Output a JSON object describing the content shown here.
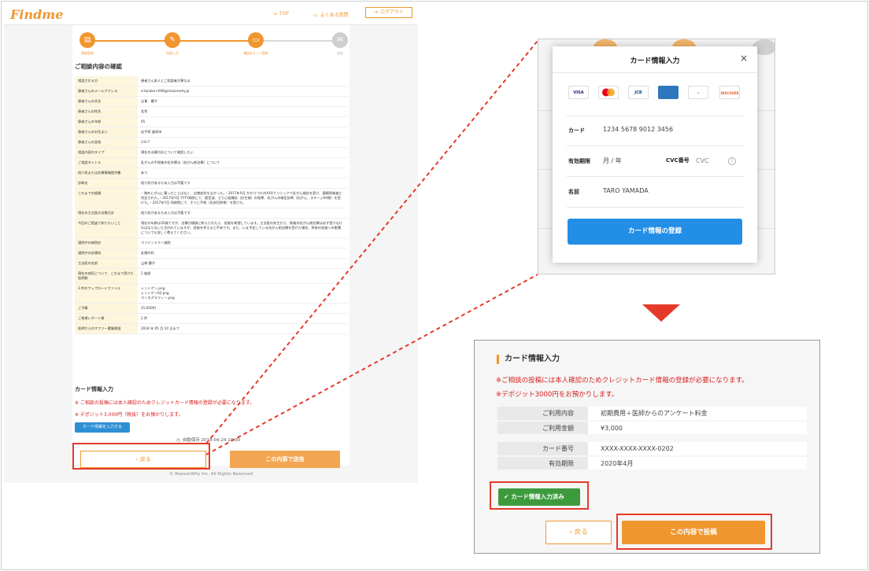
{
  "left_page": {
    "logo": "Findme",
    "nav": {
      "top": "TOP",
      "faq": "よくある質問",
      "logout": "ログアウト"
    },
    "steps": [
      "相談登録",
      "内容入力",
      "確認&カード登録",
      "送信"
    ],
    "title": "ご相談内容の確認",
    "rows": [
      {
        "k": "相談される方",
        "v": "患者さん本人とご相談者が異なる"
      },
      {
        "k": "患者さんのメールアドレス",
        "v": "d.tanaka+008@reasonwhy.jp"
      },
      {
        "k": "患者さんの氏名",
        "v": "吉軍　暮子"
      },
      {
        "k": "患者さんの性別",
        "v": "女性"
      },
      {
        "k": "患者さんの年齢",
        "v": "65"
      },
      {
        "k": "患者さんのお住まい",
        "v": "岩手県 盛岡市"
      },
      {
        "k": "患者さんの身長",
        "v": "3-6-7"
      },
      {
        "k": "相談内容のタイプ",
        "v": "現在の治療方針について確認したい"
      },
      {
        "k": "ご相談タイトル",
        "v": "乳がんの手術後の化学療法（抗がん剤治療）について"
      },
      {
        "k": "紹介状または診療情報提供書",
        "v": "あり"
      },
      {
        "k": "診断名",
        "v": "紹介状があるため入力は不要です"
      },
      {
        "k": "これまでの経緯",
        "v": "・胸をにがんに罹ったことはなく、自覚症状もなかった。・2017年X月 かかりつけのXXXクリニックで乳がん検診を受け、要精密検査と判定された。・2017年Y月 YYYY病院にて、超音波、さらに組織診（針生検）の結果、乳がんの確定診断（乳がん、ステージIIA期）を受けた。・2017年Y月 同病院にて、すぐに手術（乳房切除術）を受けた。"
      },
      {
        "k": "現在の主治医の治療方針",
        "v": "紹介状があるため入力は不要です"
      },
      {
        "k": "今回のご相談で知りたいこと",
        "v": "現在の年齢は35歳ですが、治療が順調に終えられたら、妊娠を希望しています。主治医の先生から、術後の抗がん剤治療は必ず受けなければならないと言われていますが、妊娠を考えると不安です。まだ、いま予定している抗がん剤治療を受けた場合、将来の妊娠への影響についても詳しく教えてください。"
      },
      {
        "k": "通院中の病院名",
        "v": "ファインドミー病院"
      },
      {
        "k": "通院中の診療科",
        "v": "乳腺外科"
      },
      {
        "k": "主治医の名前",
        "v": "山﨑 暮子"
      },
      {
        "k": "現在の病気について、これまで受けた医師数",
        "v": "2 施設"
      },
      {
        "k": "3 件のアップロードファイル",
        "v": "レントゲン.png\nレントゲン02.png\nマンモグラフィー.png"
      },
      {
        "k": "ご予算",
        "v": "25,000円"
      },
      {
        "k": "ご希望レポート数",
        "v": "2 件"
      },
      {
        "k": "医師からのオファー募集期限",
        "v": "2018 年 05 月 10 日まで"
      }
    ],
    "card_section_title": "カード情報入力",
    "card_note_1": "※ ご相談の投稿には本人確認のためクレジットカード情報の登録が必要になります。",
    "card_note_2": "※ デポジット3,000円（税抜）をお預かりします。",
    "card_input_button": "カード情報を入力する",
    "autosave": "自動保存 2018-04-24 10:30",
    "back_button": "戻る",
    "submit_button": "この内容で送信",
    "copyright": "© ReasonWhy Inc. All Rights Reserved"
  },
  "modal": {
    "title": "カード情報入力",
    "close": "×",
    "brands": [
      "VISA",
      "mastercard",
      "JCB",
      "AMERICAN EXPRESS",
      "Diners Club",
      "DISCOVER"
    ],
    "card_label": "カード",
    "card_placeholder": "1234 5678 9012 3456",
    "expiry_label": "有効期限",
    "expiry_placeholder": "月 / 年",
    "cvc_label": "CVC番号",
    "cvc_placeholder": "CVC",
    "name_label": "名前",
    "name_placeholder": "TARO YAMADA",
    "register_button": "カード情報の登録"
  },
  "result": {
    "title": "カード情報入力",
    "note_1": "※ご相談の投稿には本人確認のためクレジットカード情報の登録が必要になります。",
    "note_2": "※デポジット3000円をお預かりします。",
    "rows_a": [
      {
        "k": "ご利用内容",
        "v": "初期費用＋医師からのアンケート料金"
      },
      {
        "k": "ご利用金額",
        "v": "¥3,000"
      }
    ],
    "rows_b": [
      {
        "k": "カード番号",
        "v": "XXXX-XXXX-XXXX-0202"
      },
      {
        "k": "有効期限",
        "v": "2020年4月"
      }
    ],
    "done_button": "カード情報入力済み",
    "back_button": "戻る",
    "submit_button": "この内容で投稿"
  },
  "colors": {
    "accent": "#f0962f",
    "alert": "#e53a2a",
    "primary_blue": "#238ee6",
    "success": "#3d9a3d"
  }
}
